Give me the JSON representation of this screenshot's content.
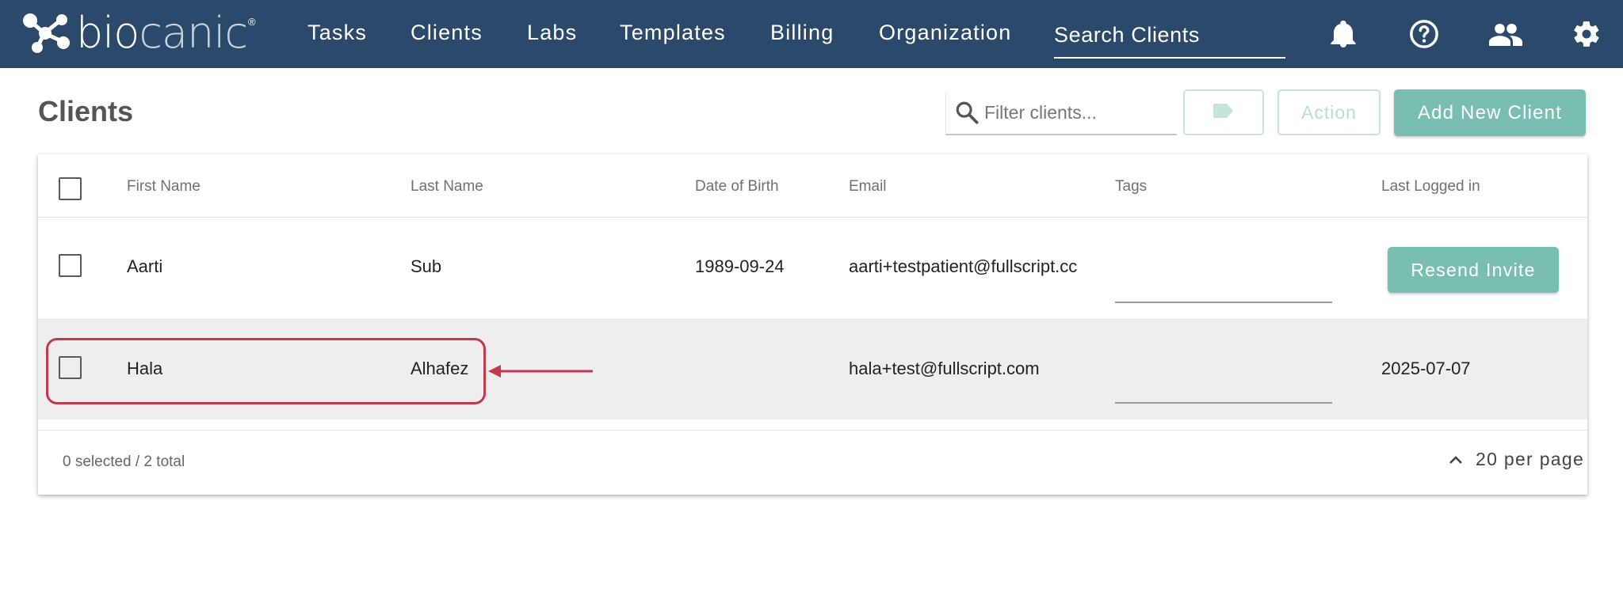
{
  "nav": {
    "logo_bio": "bio",
    "logo_canic": "canic",
    "logo_reg": "®",
    "items": [
      "Tasks",
      "Clients",
      "Labs",
      "Templates",
      "Billing",
      "Organization"
    ],
    "search_placeholder": "Search Clients",
    "icons": [
      "bell-icon",
      "help-circle-icon",
      "people-icon",
      "gear-icon"
    ]
  },
  "page": {
    "title": "Clients",
    "filter_placeholder": "Filter clients...",
    "tag_button_icon": "label-icon",
    "action_label": "Action",
    "add_label": "Add New Client"
  },
  "table": {
    "columns": [
      "First Name",
      "Last Name",
      "Date of Birth",
      "Email",
      "Tags",
      "Last Logged in"
    ],
    "rows": [
      {
        "first": "Aarti",
        "last": "Sub",
        "dob": "1989-09-24",
        "email": "aarti+testpatient@fullscript.cc",
        "tags": "",
        "last_logged": "",
        "action": "Resend Invite"
      },
      {
        "first": "Hala",
        "last": "Alhafez",
        "dob": "",
        "email": "hala+test@fullscript.com",
        "tags": "",
        "last_logged": "2025-07-07",
        "action": ""
      }
    ],
    "footer_count": "0 selected / 2 total",
    "per_page": "20 per page"
  },
  "colors": {
    "nav_bg": "#2b4a6b",
    "accent": "#7abeb1",
    "annotation": "#c2384d"
  }
}
